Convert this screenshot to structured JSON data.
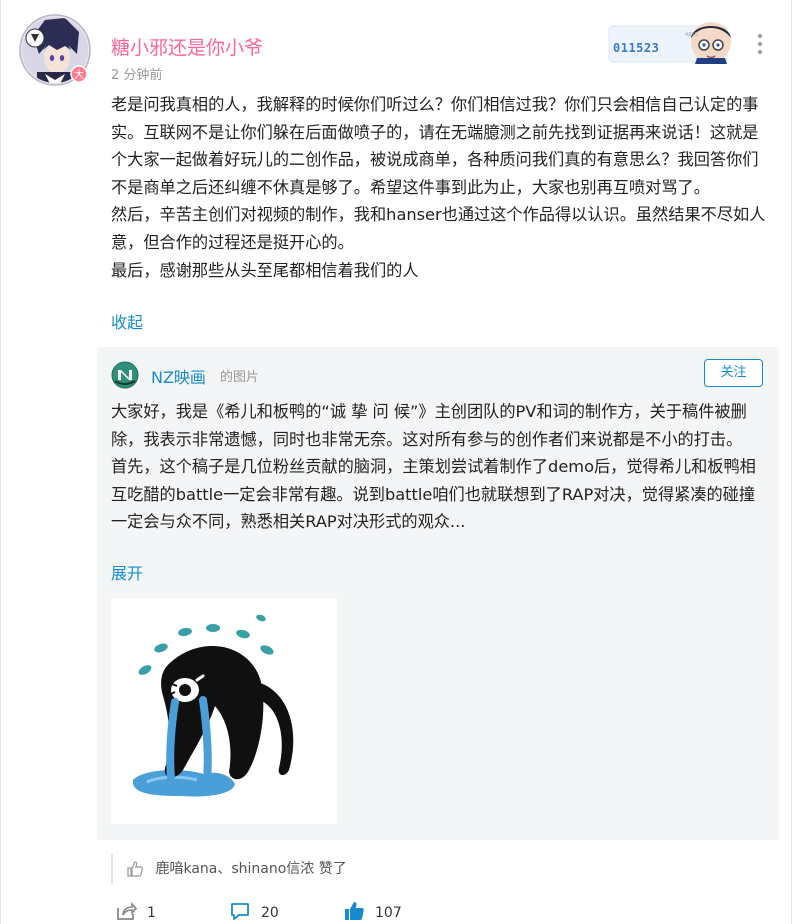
{
  "post": {
    "username": "糖小邪还是你小爷",
    "timestamp": "2 分钟前",
    "badge_number": "011523",
    "paragraphs": [
      "老是问我真相的人，我解释的时候你们听过么？你们相信过我？你们只会相信自己认定的事实。互联网不是让你们躲在后面做喷子的，请在无端臆测之前先找到证据再来说话！这就是个大家一起做着好玩儿的二创作品，被说成商单，各种质问我们真的有意思么？我回答你们不是商单之后还纠缠不休真是够了。希望这件事到此为止，大家也别再互喷对骂了。",
      "然后，辛苦主创们对视频的制作，我和hanser也通过这个作品得以认识。虽然结果不尽如人意，但合作的过程还是挺开心的。",
      "最后，感谢那些从头至尾都相信着我们的人"
    ],
    "collapse_label": "收起"
  },
  "repost": {
    "author": "NZ映画",
    "type_label": "的图片",
    "follow_label": "关注",
    "paragraphs": [
      "大家好，我是《希儿和板鸭的“诚 挚 问 候”》主创团队的PV和词的制作方，关于稿件被删除，我表示非常遗憾，同时也非常无奈。这对所有参与的创作者们来说都是不小的打击。",
      "首先，这个稿子是几位粉丝贡献的脑洞，主策划尝试着制作了demo后，觉得希儿和板鸭相互吃醋的battle一定会非常有趣。说到battle咱们也就联想到了RAP对决，觉得紧凑的碰撞一定会与众不同，熟悉相关RAP对决形式的观众..."
    ],
    "expand_label": "展开"
  },
  "likes": {
    "text": "鹿喑kana、shinano信浓 赞了"
  },
  "actions": {
    "share_count": "1",
    "comment_count": "20",
    "like_count": "107"
  },
  "colors": {
    "link": "#178bcf",
    "username": "#ff6699",
    "muted": "#999999",
    "repost_bg": "#f4f5f7"
  },
  "icons": [
    "more-icon",
    "share-icon",
    "comment-icon",
    "thumbs-up-icon",
    "like-icon"
  ]
}
